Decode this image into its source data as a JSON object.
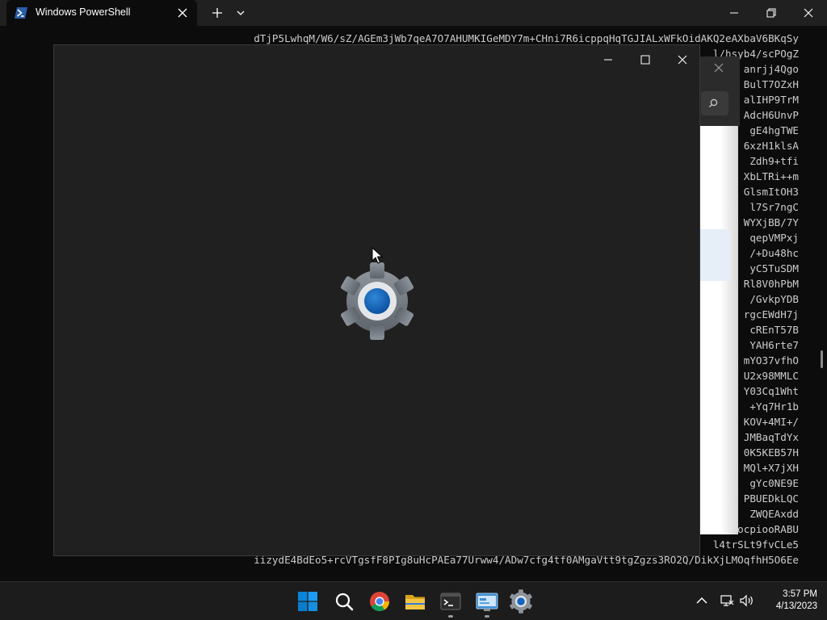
{
  "terminal": {
    "tab_title": "Windows PowerShell",
    "lines": [
      "dTjP5LwhqM/W6/sZ/AGEm3jWb7qeA7O7AHUMKIGeMDY7m+CHni7R6icppqHqTGJIALxWFkOidAKQ2eAXbaV6BKqSy",
      "l/hsyb4/scPOgZ",
      "anrjj4Qgo",
      "BulT7OZxH",
      "alIHP9TrM",
      "AdcH6UnvP",
      "gE4hgTWE",
      "6xzH1klsA",
      "Zdh9+tfi",
      "XbLTRi++m",
      "GlsmItOH3",
      "l7Sr7ngC",
      "WYXjBB/7Y",
      "qepVMPxj",
      "/+Du48hc",
      "yC5TuSDM",
      "Rl8V0hPbM",
      "/GvkpYDB",
      "rgcEWdH7j",
      "cREnT57B",
      "YAH6rte7",
      "mYO37vfhO",
      "U2x98MMLC",
      "Y03Cq1Wht",
      "+Yq7Hr1b",
      "KOV+4MI+/",
      "JMBaqTdYx",
      "0K5KEB57H",
      "MQl+X7jXH",
      "gYc0NE9E",
      "PBUEDkLQC",
      "ZWQEAxdd",
      "ocpiooRABU",
      "l4trSLt9fvCLe5",
      "iizydE4BdEo5+rcVTgsfF8PIg8uHcPAEa77Urww4/ADw7cfg4tf0AMgaVtt9tgZgzs3RO2Q/DikXjLMOqfhH5O6Ee"
    ]
  },
  "taskbar": {
    "apps": [
      {
        "name": "start-button",
        "icon": "windows-logo-icon",
        "running": false
      },
      {
        "name": "search-button",
        "icon": "search-icon",
        "running": false
      },
      {
        "name": "chrome-button",
        "icon": "chrome-icon",
        "running": false
      },
      {
        "name": "file-explorer-button",
        "icon": "folder-icon",
        "running": false
      },
      {
        "name": "terminal-button",
        "icon": "terminal-icon",
        "running": true
      },
      {
        "name": "control-panel-button",
        "icon": "control-panel-icon",
        "running": true
      },
      {
        "name": "settings-button",
        "icon": "gear-icon",
        "running": false
      }
    ],
    "time": "3:57 PM",
    "date": "4/13/2023"
  },
  "colors": {
    "accent": "#0067c0",
    "terminal_bg": "#0c0c0c",
    "splash_bg": "#202020",
    "taskbar_bg": "#1c1c1c"
  }
}
